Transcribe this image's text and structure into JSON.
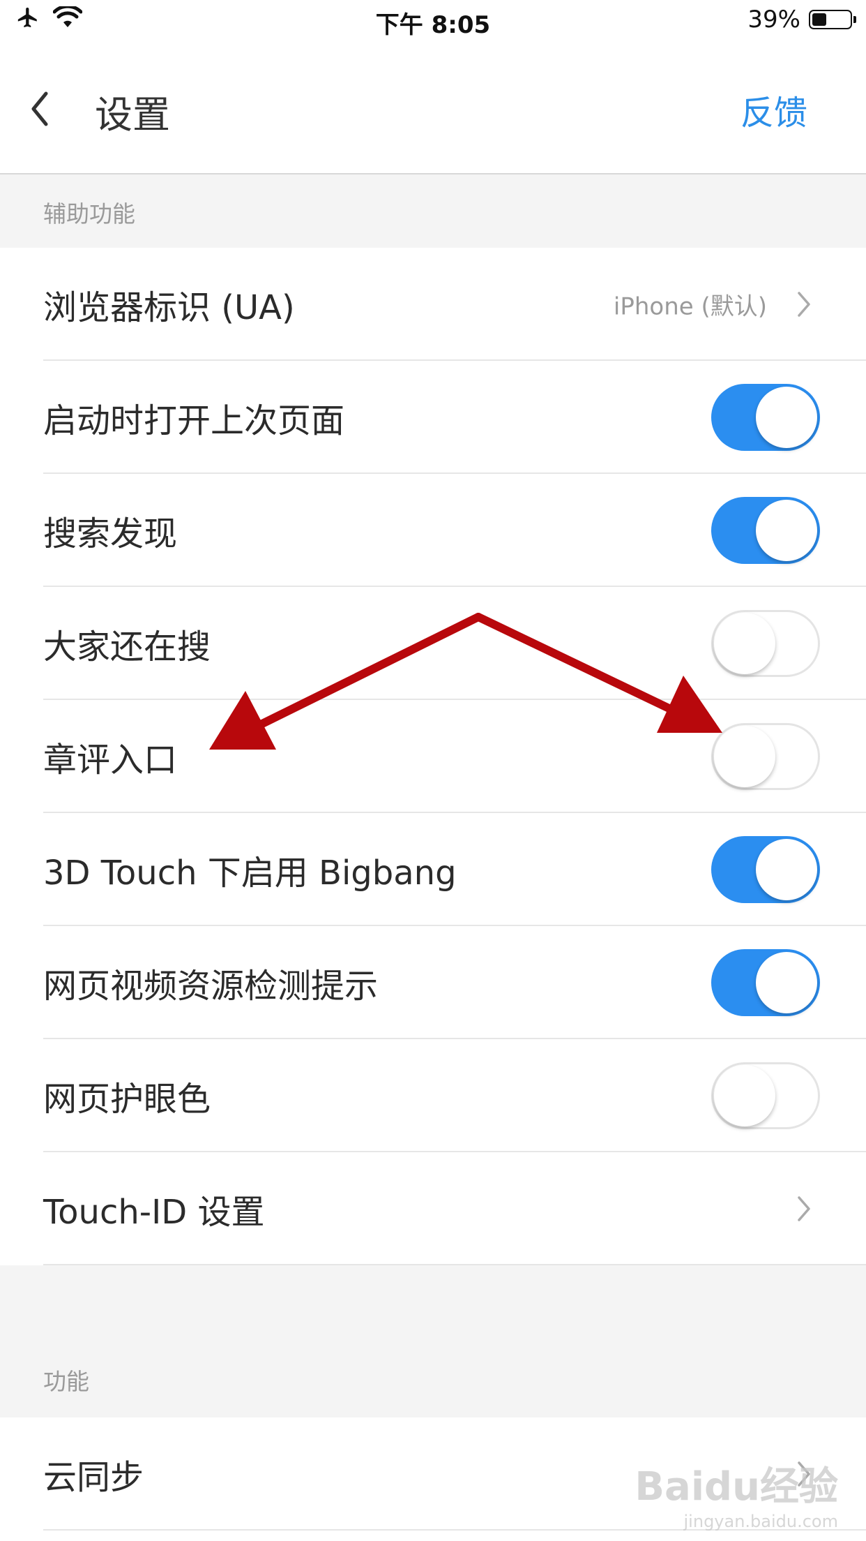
{
  "status_bar": {
    "time": "下午 8:05",
    "battery": "39%",
    "battery_level": 0.39
  },
  "nav": {
    "title": "设置",
    "feedback": "反馈"
  },
  "sections": {
    "assist": {
      "header": "辅助功能",
      "rows": {
        "ua": {
          "label": "浏览器标识 (UA)",
          "value": "iPhone (默认)"
        },
        "restore": {
          "label": "启动时打开上次页面",
          "on": true
        },
        "discover": {
          "label": "搜索发现",
          "on": true
        },
        "trending": {
          "label": "大家还在搜",
          "on": false
        },
        "comments": {
          "label": "章评入口",
          "on": false
        },
        "bigbang": {
          "label": "3D Touch 下启用 Bigbang",
          "on": true
        },
        "video": {
          "label": "网页视频资源检测提示",
          "on": true
        },
        "eyecare": {
          "label": "网页护眼色",
          "on": false
        },
        "touchid": {
          "label": "Touch-ID 设置"
        }
      }
    },
    "features": {
      "header": "功能",
      "rows": {
        "cloudsync": {
          "label": "云同步"
        }
      }
    }
  },
  "watermark": {
    "main": "Baidu经验",
    "sub": "jingyan.baidu.com"
  },
  "colors": {
    "accent": "#2b8ef0",
    "link": "#2b8ee8",
    "arrow": "#b8080c"
  }
}
